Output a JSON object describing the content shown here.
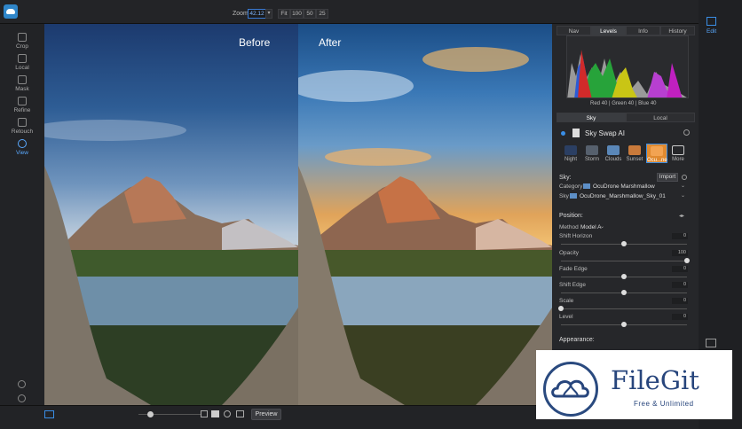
{
  "toolbar": {
    "zoom_label": "Zoom",
    "zoom_value": "42.12",
    "fit_label": "Fit",
    "zoom_presets": [
      "100",
      "50",
      "25"
    ]
  },
  "left_tools": [
    {
      "label": "Crop",
      "icon": "crop-icon"
    },
    {
      "label": "Local",
      "icon": "local-brush-icon"
    },
    {
      "label": "Mask",
      "icon": "mask-icon"
    },
    {
      "label": "Refine",
      "icon": "refine-icon"
    },
    {
      "label": "Retouch",
      "icon": "retouch-icon"
    },
    {
      "label": "View",
      "icon": "view-icon"
    }
  ],
  "images": {
    "before_label": "Before",
    "after_label": "After"
  },
  "bottom": {
    "preview_label": "Preview"
  },
  "right_nav": {
    "edit_label": "Edit"
  },
  "panel": {
    "tabs": [
      "Nav",
      "Levels",
      "Info",
      "History"
    ],
    "selected_tab": "Levels",
    "rgb_readout": "Red  40  | Green  40  | Blue  40",
    "mode_tabs": [
      "Sky",
      "Local"
    ],
    "selected_mode": "Sky",
    "module_title": "Sky Swap AI",
    "sky_categories": [
      "Night",
      "Storm",
      "Clouds",
      "Sunset",
      "Ocu...ne",
      "More"
    ],
    "selected_category": "Ocu...ne",
    "sky_heading": "Sky:",
    "import_label": "Import",
    "category_label": "Category",
    "category_value": "OcuDrone Marshmallow",
    "sky_label": "Sky",
    "sky_value": "OcuDrone_Marshmallow_Sky_01",
    "position_heading": "Position:",
    "method_label": "Method",
    "method_value": "Model A",
    "sliders": [
      {
        "label": "Shift Horizon",
        "value": "0",
        "fraction": 0.5
      },
      {
        "label": "Opacity",
        "value": "100",
        "fraction": 1.0
      },
      {
        "label": "Fade Edge",
        "value": "0",
        "fraction": 0.5
      },
      {
        "label": "Shift Edge",
        "value": "0",
        "fraction": 0.5
      },
      {
        "label": "Scale",
        "value": "0",
        "fraction": 0.0
      },
      {
        "label": "Level",
        "value": "0",
        "fraction": 0.5
      }
    ],
    "appearance_heading": "Appearance:"
  },
  "watermark": {
    "title": "FileGit",
    "subtitle": "Free & Unlimited"
  },
  "colors": {
    "accent": "#3a8ee6",
    "panel_bg": "#26272a",
    "watermark_blue": "#27457c"
  }
}
